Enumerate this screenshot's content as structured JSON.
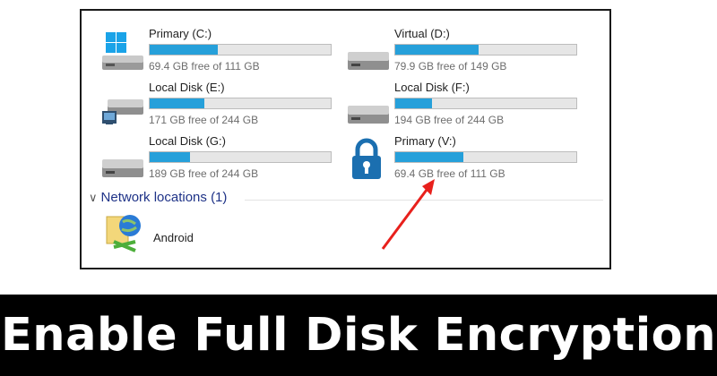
{
  "drives": [
    {
      "name": "Primary (C:)",
      "free_text": "69.4 GB free of 111 GB",
      "used_fraction": 0.375,
      "icon": "windows-drive-icon"
    },
    {
      "name": "Virtual (D:)",
      "free_text": "79.9 GB free of 149 GB",
      "used_fraction": 0.46,
      "icon": "hard-drive-icon"
    },
    {
      "name": "Local Disk (E:)",
      "free_text": "171 GB free of 244 GB",
      "used_fraction": 0.3,
      "icon": "network-drive-icon"
    },
    {
      "name": "Local Disk (F:)",
      "free_text": "194 GB free of 244 GB",
      "used_fraction": 0.205,
      "icon": "hard-drive-icon"
    },
    {
      "name": "Local Disk (G:)",
      "free_text": "189 GB free of 244 GB",
      "used_fraction": 0.225,
      "icon": "hard-drive-icon"
    },
    {
      "name": "Primary (V:)",
      "free_text": "69.4 GB free of 111 GB",
      "used_fraction": 0.375,
      "icon": "lock-icon"
    }
  ],
  "network": {
    "header": "Network locations (1)",
    "items": [
      {
        "label": "Android",
        "icon": "network-location-icon"
      }
    ]
  },
  "banner": {
    "title": "Enable Full Disk Encryption"
  },
  "colors": {
    "bar_fill": "#26a0da",
    "bar_bg": "#e6e6e6",
    "network_header": "#1e3287",
    "arrow": "#e8201c",
    "lock": "#1b6fb0",
    "banner_bg": "#000000"
  }
}
